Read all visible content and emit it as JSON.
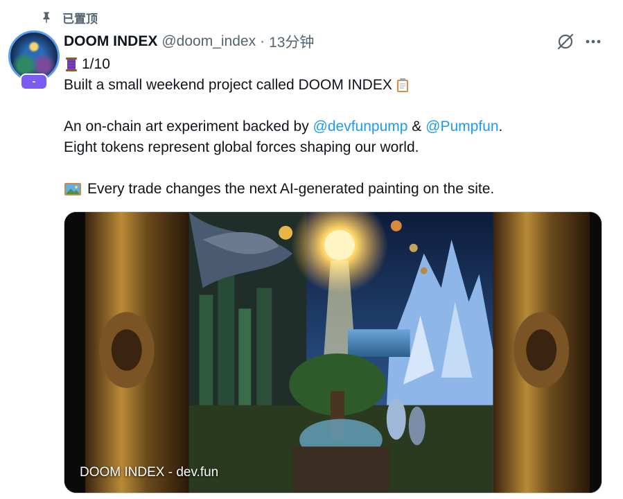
{
  "pinned_label": "已置顶",
  "author": {
    "display_name": "DOOM INDEX",
    "handle": "@doom_index",
    "separator": "·",
    "time": "13分钟",
    "badge": "-"
  },
  "post": {
    "thread_marker": "1/10",
    "line1": "Built a small weekend project called DOOM INDEX",
    "line2_before": "An on-chain art experiment backed by",
    "mention1": "@devfunpump",
    "amp": "&",
    "mention2": "@Pumpfun",
    "line2_after": ".",
    "line3": "Eight tokens represent global forces shaping our world.",
    "line4": "Every trade changes the next AI-generated painting on the site."
  },
  "media": {
    "caption": "DOOM INDEX - dev.fun"
  },
  "icons": {
    "pin": "pin-icon",
    "grok": "grok-icon",
    "more": "more-icon",
    "thread": "spool-emoji",
    "clipboard": "clipboard-emoji",
    "picture": "framed-picture-emoji"
  },
  "colors": {
    "link": "#1d9bf0",
    "muted": "#536471",
    "avatar_ring": "#5b9ef0",
    "badge": "#7a5cf0"
  }
}
